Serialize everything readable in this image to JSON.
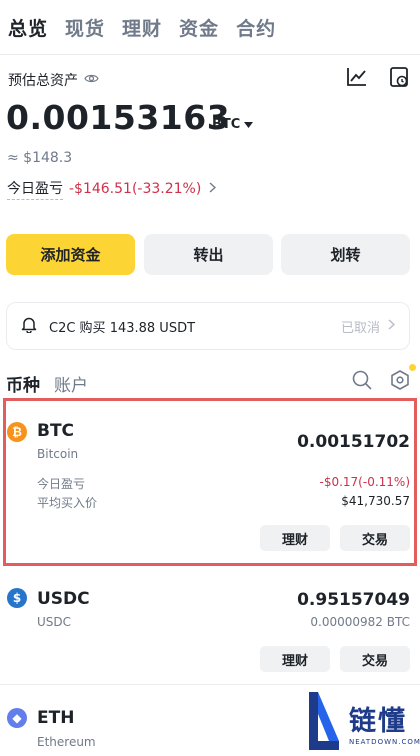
{
  "top_tabs": [
    "总览",
    "现货",
    "理财",
    "资金",
    "合约"
  ],
  "header": {
    "est_label": "预估总资产",
    "balance": "0.00153163",
    "currency": "BTC",
    "approx": "≈ $148.3",
    "pnl_label": "今日盈亏",
    "pnl_value": "-$146.51(-33.21%)"
  },
  "buttons": {
    "deposit": "添加资金",
    "withdraw": "转出",
    "transfer": "划转"
  },
  "notice": {
    "text": "C2C 购买 143.88 USDT",
    "status": "已取消"
  },
  "sub_tabs": [
    "币种",
    "账户"
  ],
  "assets": [
    {
      "symbol": "BTC",
      "name": "Bitcoin",
      "amount": "0.00151702",
      "pnl_label": "今日盈亏",
      "pnl_value": "-$0.17(-0.11%)",
      "avg_label": "平均买入价",
      "avg_value": "$41,730.57",
      "btn_earn": "理财",
      "btn_trade": "交易",
      "icon": "bitcoin-icon",
      "color": "#f7931a"
    },
    {
      "symbol": "USDC",
      "name": "USDC",
      "amount": "0.95157049",
      "sub_amount": "0.00000982 BTC",
      "btn_earn": "理财",
      "btn_trade": "交易",
      "icon": "usdc-icon",
      "color": "#2775ca"
    },
    {
      "symbol": "ETH",
      "name": "Ethereum",
      "icon": "ethereum-icon",
      "color": "#627eea"
    }
  ],
  "watermark": {
    "cn": "链懂",
    "en": "NEATDOWN.COM"
  }
}
